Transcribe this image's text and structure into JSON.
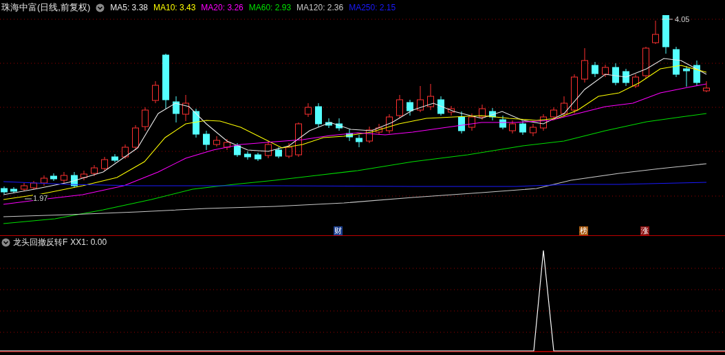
{
  "title_bar": {
    "title": "珠海中富(日线,前复权)",
    "moving_averages": [
      {
        "label": "MA5: 3.38",
        "color": "#e8e8e8"
      },
      {
        "label": "MA10: 3.43",
        "color": "#ffff00"
      },
      {
        "label": "MA20: 3.26",
        "color": "#ff00ff"
      },
      {
        "label": "MA60: 2.93",
        "color": "#00e000"
      },
      {
        "label": "MA120: 2.36",
        "color": "#c8c8c8"
      },
      {
        "label": "MA250: 2.15",
        "color": "#1a1aff"
      }
    ]
  },
  "main_chart": {
    "high_label": "4.05",
    "low_label": "1.97",
    "event_markers": [
      {
        "label": "财",
        "color": "#1c3f8f"
      },
      {
        "label": "榜",
        "color": "#a85a10"
      },
      {
        "label": "涨",
        "color": "#8a1010"
      }
    ]
  },
  "indicator_panel": {
    "name": "龙头回撤反转F",
    "reading": "XX1: 0.00"
  }
}
